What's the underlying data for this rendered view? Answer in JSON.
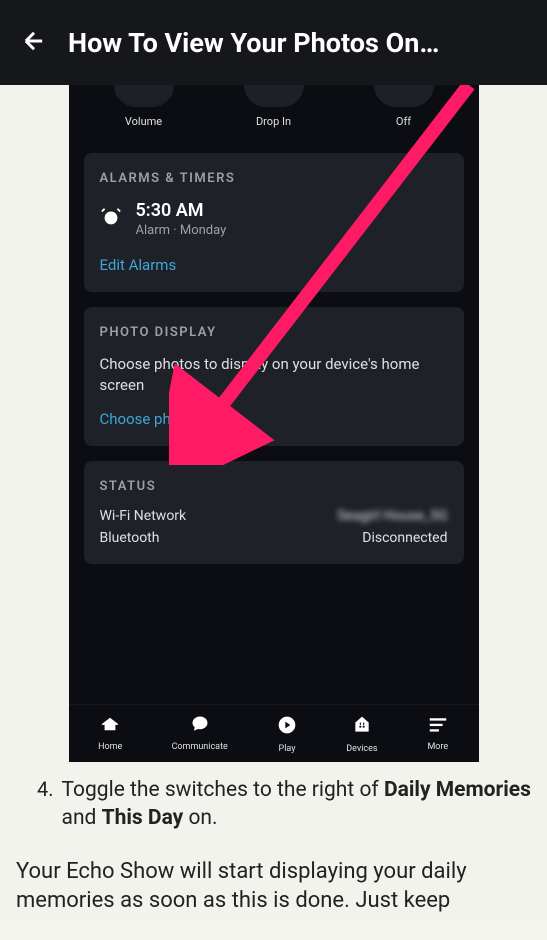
{
  "header": {
    "title": "How To View Your Photos On…"
  },
  "controls": {
    "volume": "Volume",
    "dropin": "Drop In",
    "off": "Off"
  },
  "alarms": {
    "title": "ALARMS & TIMERS",
    "time": "5:30 AM",
    "sub": "Alarm · Monday",
    "edit": "Edit Alarms"
  },
  "photo": {
    "title": "PHOTO DISPLAY",
    "desc": "Choose photos to display on your device's home screen",
    "link": "Choose photos"
  },
  "status": {
    "title": "STATUS",
    "wifi_label": "Wi-Fi Network",
    "wifi_value": "Seagirl House_5G",
    "bt_label": "Bluetooth",
    "bt_value": "Disconnected"
  },
  "nav": {
    "home": "Home",
    "communicate": "Communicate",
    "play": "Play",
    "devices": "Devices",
    "more": "More"
  },
  "article": {
    "step_num": "4.",
    "step_text_1": "Toggle the switches to the right of ",
    "step_bold_1": "Daily Memories",
    "step_text_2": " and ",
    "step_bold_2": "This Day",
    "step_text_3": " on.",
    "para": "Your Echo Show will start displaying your daily memories as soon as this is done. Just keep"
  }
}
